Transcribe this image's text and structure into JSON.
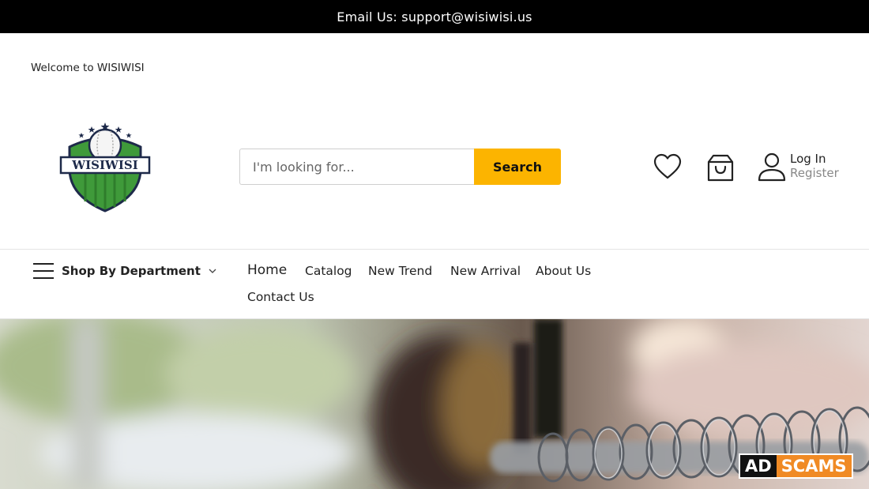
{
  "topbar": {
    "email_text": "Email Us: support@wisiwisi.us"
  },
  "header": {
    "welcome": "Welcome to WISIWISI",
    "logo_text": "WISIWISI",
    "search": {
      "placeholder": "I'm looking for...",
      "button_label": "Search"
    },
    "icons": [
      "heart-icon",
      "shopping-bag-icon",
      "user-icon"
    ],
    "account": {
      "login": "Log In",
      "register": "Register"
    }
  },
  "nav": {
    "department_label": "Shop By Department",
    "items": [
      "Home",
      "Catalog",
      "New Trend",
      "New Arrival",
      "About Us",
      "Contact Us"
    ]
  },
  "badge": {
    "left": "AD",
    "right": "SCAMS"
  },
  "colors": {
    "accent": "#fcb400",
    "topbar": "#000000",
    "logo_green": "#3f9a3a",
    "logo_navy": "#1e2a4a",
    "badge_orange": "#f08a24"
  }
}
